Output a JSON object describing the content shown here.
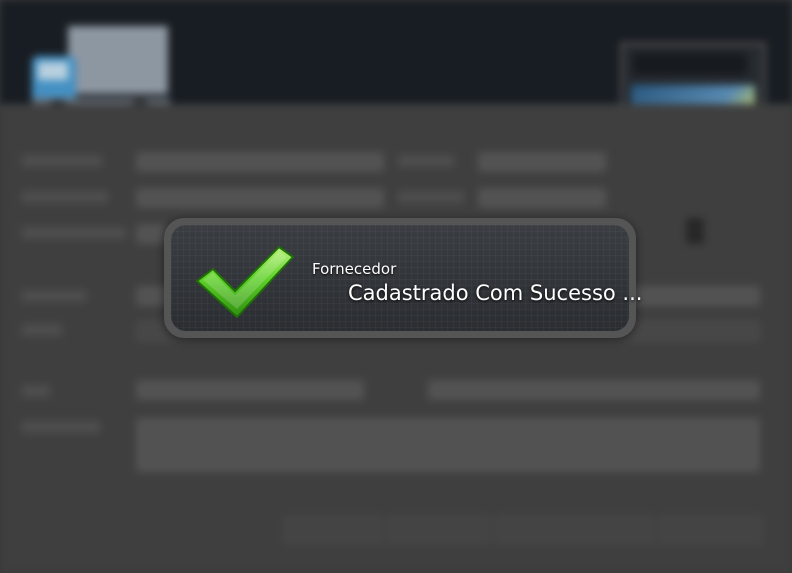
{
  "notification": {
    "title": "Fornecedor",
    "message": "Cadastrado Com Sucesso ..."
  },
  "colors": {
    "check_green": "#44c21a",
    "check_highlight": "#b9f27a",
    "toast_border": "#555555",
    "toast_fill": "#2f3337",
    "header_bg": "#1b2026"
  },
  "icons": {
    "notification_icon": "checkmark-icon",
    "header_icon": "truck-icon"
  }
}
